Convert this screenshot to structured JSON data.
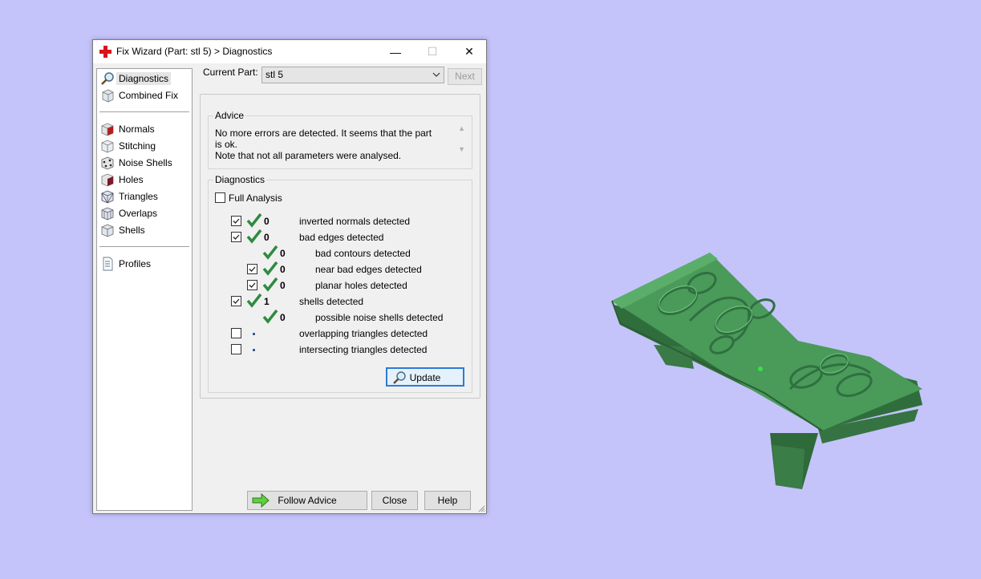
{
  "window": {
    "title": "Fix Wizard (Part: stl 5) > Diagnostics",
    "minimize": "—",
    "maximize": "☐",
    "close": "✕"
  },
  "sidebar": {
    "items": [
      {
        "label": "Diagnostics",
        "icon": "magnifier-icon"
      },
      {
        "label": "Combined Fix",
        "icon": "cube-icon"
      },
      {
        "label": "Normals",
        "icon": "normals-cube-icon"
      },
      {
        "label": "Stitching",
        "icon": "stitching-cube-icon"
      },
      {
        "label": "Noise Shells",
        "icon": "noise-shells-icon"
      },
      {
        "label": "Holes",
        "icon": "holes-cube-icon"
      },
      {
        "label": "Triangles",
        "icon": "triangles-cube-icon"
      },
      {
        "label": "Overlaps",
        "icon": "overlaps-cube-icon"
      },
      {
        "label": "Shells",
        "icon": "shells-cube-icon"
      },
      {
        "label": "Profiles",
        "icon": "document-icon"
      }
    ]
  },
  "current_part": {
    "label": "Current Part:",
    "value": "stl 5",
    "next_label": "Next"
  },
  "advice": {
    "title": "Advice",
    "line1": "No more errors are detected. It seems that the part is ok.",
    "line2": "Note that not all parameters were analysed."
  },
  "diagnostics": {
    "title": "Diagnostics",
    "full_analysis_label": "Full Analysis",
    "rows": [
      {
        "count": "0",
        "label": "inverted normals detected"
      },
      {
        "count": "0",
        "label": "bad edges detected"
      },
      {
        "count": "0",
        "label": "bad contours detected"
      },
      {
        "count": "0",
        "label": "near bad edges detected"
      },
      {
        "count": "0",
        "label": "planar holes detected"
      },
      {
        "count": "1",
        "label": "shells detected"
      },
      {
        "count": "0",
        "label": "possible noise shells detected"
      },
      {
        "count": "",
        "label": "overlapping triangles detected"
      },
      {
        "count": "",
        "label": "intersecting triangles detected"
      }
    ],
    "update_label": "Update"
  },
  "footer": {
    "follow_advice_label": "Follow Advice",
    "close_label": "Close",
    "help_label": "Help"
  },
  "colors": {
    "background": "#c4c4fa",
    "model_green": "#3f8f4f",
    "check_green": "#2e8b3e"
  }
}
